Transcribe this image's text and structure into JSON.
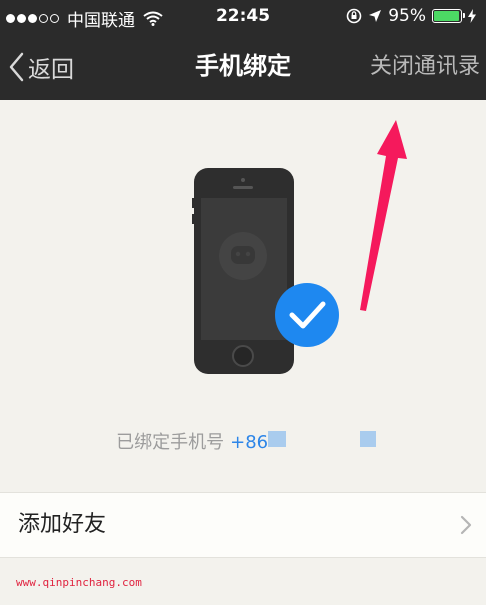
{
  "status_bar": {
    "carrier": "中国联通",
    "time": "22:45",
    "battery": "95%",
    "battery_level": 0.95,
    "signal_bars_filled": 3,
    "signal_bars_total": 5
  },
  "nav": {
    "back_label": "返回",
    "title": "手机绑定",
    "right_label": "关闭通讯录"
  },
  "bound": {
    "label": "已绑定手机号",
    "number": "+86"
  },
  "list": {
    "add_friends_label": "添加好友"
  },
  "watermark": "www.qinpinchang.com",
  "colors": {
    "nav_background": "#2b2b2b",
    "page_background": "#f3f2ed",
    "check_blue": "#1e88f0",
    "number_blue": "#2d86e8",
    "arrow_pink": "#f5195c",
    "battery_green": "#4cd964"
  }
}
